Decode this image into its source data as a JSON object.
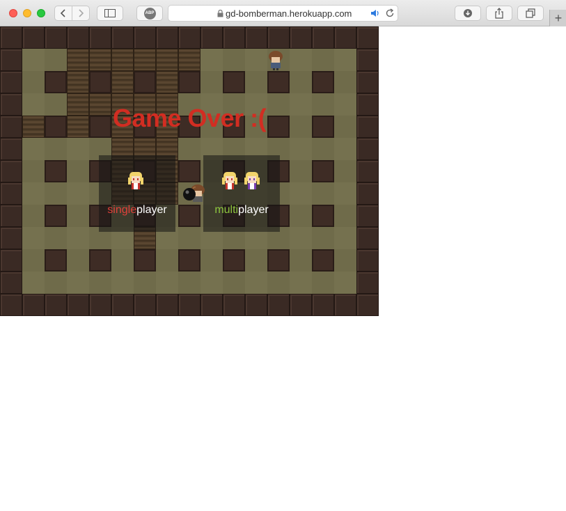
{
  "browser": {
    "url": "gd-bomberman.herokuapp.com",
    "abp_label": "ABP"
  },
  "game": {
    "title": "Game Over :(",
    "singleplayer": {
      "prefix": "single",
      "suffix": "player",
      "prefix_color": "#e0413a"
    },
    "multiplayer": {
      "prefix": "multi",
      "suffix": "player",
      "prefix_color": "#8dc63f"
    }
  },
  "icons": [
    "back-icon",
    "forward-icon",
    "sidebar-icon",
    "lock-icon",
    "speaker-icon",
    "reload-icon",
    "download-icon",
    "share-icon",
    "tabs-icon",
    "plus-icon",
    "bomb-icon"
  ]
}
